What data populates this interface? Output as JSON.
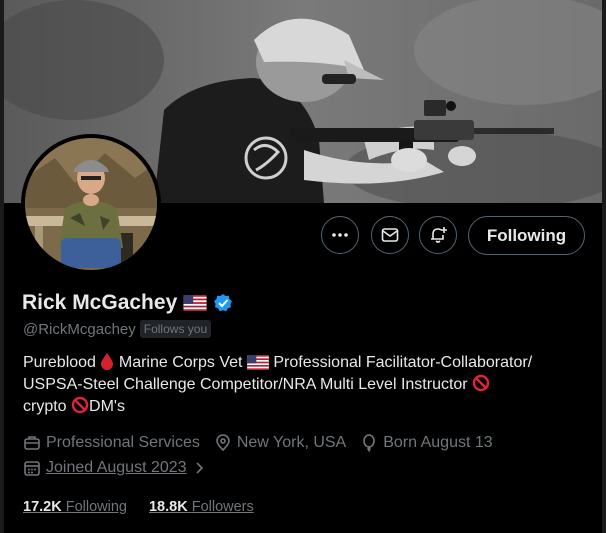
{
  "profile": {
    "display_name": "Rick McGachey",
    "handle": "@RickMcgachey",
    "follows_you_badge": "Follows you",
    "verified_color": "#1d9bf0",
    "bio_parts": {
      "p1": "Pureblood",
      "p2": "Marine Corps Vet",
      "p3": "Professional Facilitator-Collaborator/",
      "p4": "USPSA-Steel Challenge Competitor/NRA Multi Level Instructor",
      "p5": "crypto",
      "p6": "DM's"
    },
    "meta": {
      "category": "Professional Services",
      "location": "New York, USA",
      "birthday": "Born August 13",
      "joined": "Joined August 2023"
    },
    "stats": {
      "following_count": "17.2K",
      "following_label": "Following",
      "followers_count": "18.8K",
      "followers_label": "Followers"
    }
  },
  "actions": {
    "more_icon": "more-icon",
    "message_icon": "mail-icon",
    "notify_icon": "bell-plus-icon",
    "follow_label": "Following"
  },
  "colors": {
    "background": "#000000",
    "text_primary": "#e7e9ea",
    "text_secondary": "#71767b",
    "border": "#536471"
  }
}
